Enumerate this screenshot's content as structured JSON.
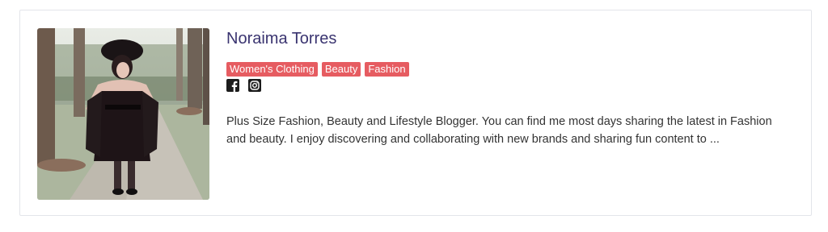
{
  "profile": {
    "name": "Noraima Torres",
    "photo_alt_icon": "profile-photo",
    "tags": [
      "Women's Clothing",
      "Beauty",
      "Fashion"
    ],
    "social_icons": [
      "facebook-icon",
      "instagram-icon"
    ],
    "bio": "Plus Size Fashion, Beauty and Lifestyle Blogger. You can find me most days sharing the latest in Fashion and beauty. I enjoy discovering and collaborating with new brands and sharing fun content to ..."
  },
  "colors": {
    "name": "#3a3470",
    "tag_bg": "#e65c61",
    "tag_text": "#ffffff",
    "bio_text": "#333333",
    "card_border": "#e3e5ea"
  }
}
